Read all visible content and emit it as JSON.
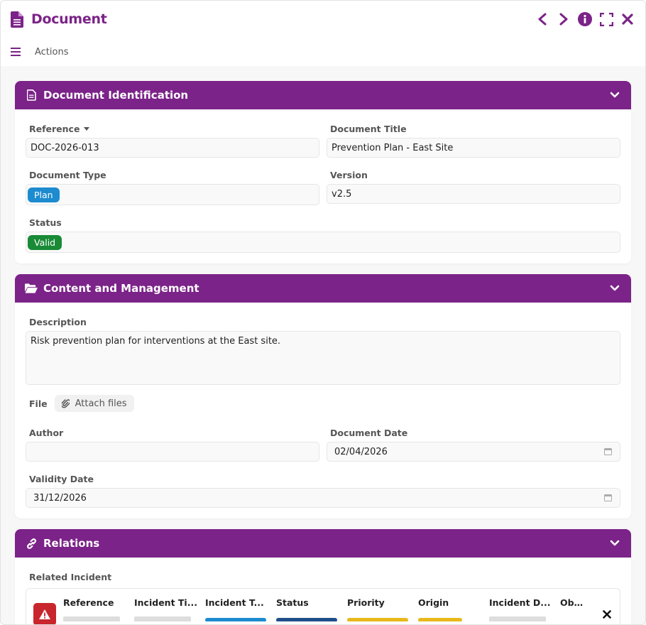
{
  "window": {
    "title": "Document",
    "actions_label": "Actions"
  },
  "sections": {
    "identification": {
      "title": "Document Identification",
      "reference_label": "Reference",
      "reference_value": "DOC-2026-013",
      "title_label": "Document Title",
      "title_value": "Prevention Plan - East Site",
      "type_label": "Document Type",
      "type_value": "Plan",
      "version_label": "Version",
      "version_value": "v2.5",
      "status_label": "Status",
      "status_value": "Valid"
    },
    "content": {
      "title": "Content and Management",
      "description_label": "Description",
      "description_value": "Risk prevention plan for interventions at the East site.",
      "file_label": "File",
      "attach_label": "Attach files",
      "author_label": "Author",
      "author_value": "",
      "document_date_label": "Document Date",
      "document_date_value": "02/04/2026",
      "validity_date_label": "Validity Date",
      "validity_date_value": "31/12/2026"
    },
    "relations": {
      "title": "Relations",
      "related_incident_label": "Related Incident",
      "columns": [
        "Reference",
        "Incident Ti...",
        "Incident T...",
        "Status",
        "Priority",
        "Origin",
        "Incident D...",
        "Observ"
      ]
    }
  },
  "colors": {
    "accent": "#7b2388",
    "plan_badge": "#1d8bcf",
    "valid_badge": "#198a36",
    "warning": "#c8262c"
  }
}
